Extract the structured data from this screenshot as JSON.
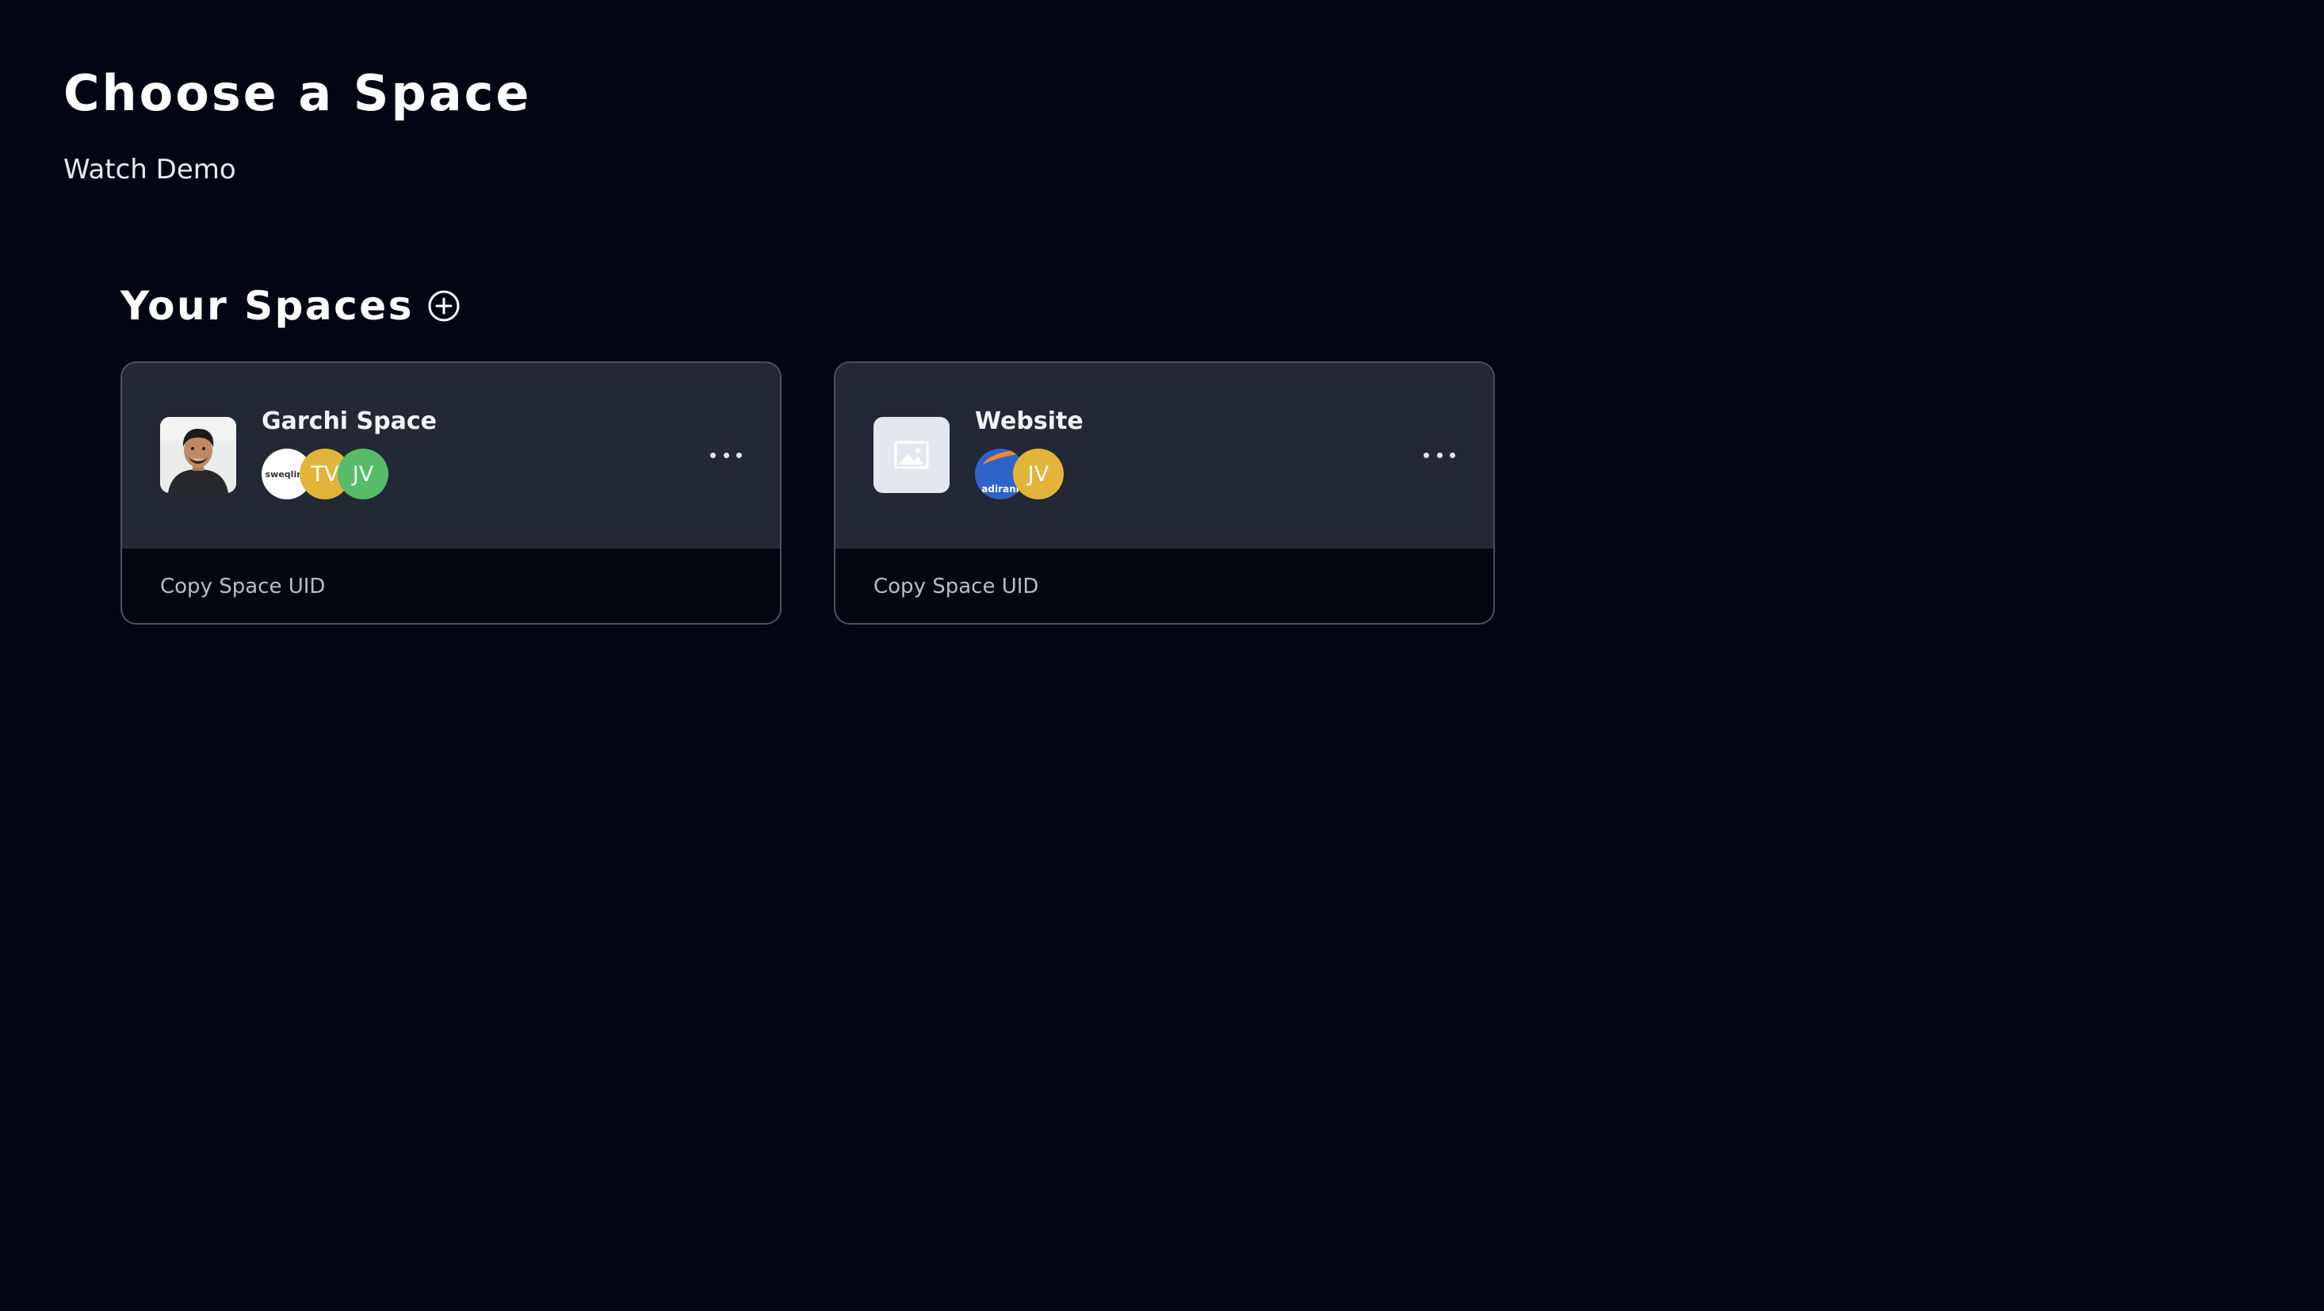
{
  "page": {
    "title": "Choose a Space",
    "watch_demo": "Watch Demo"
  },
  "section": {
    "title": "Your Spaces",
    "add_icon": "plus-circle-icon"
  },
  "spaces": [
    {
      "name": "Garchi Space",
      "thumbnail": "profile-photo",
      "members": [
        {
          "label": "sweqlink",
          "type": "logo",
          "color": "#ffffff"
        },
        {
          "label": "TV",
          "type": "initials",
          "color": "#e2b43a"
        },
        {
          "label": "JV",
          "type": "initials",
          "color": "#56bc6a"
        }
      ],
      "menu_icon": "more-horizontal-icon",
      "copy_label": "Copy Space UID"
    },
    {
      "name": "Website",
      "thumbnail": "image-placeholder-icon",
      "members": [
        {
          "label": "adirani",
          "type": "logo",
          "color": "#2f63c9"
        },
        {
          "label": "JV",
          "type": "initials",
          "color": "#e2b43a"
        }
      ],
      "menu_icon": "more-horizontal-icon",
      "copy_label": "Copy Space UID"
    }
  ],
  "colors": {
    "background": "#030612",
    "card_top": "#222934",
    "card_border": "#4a5161"
  }
}
